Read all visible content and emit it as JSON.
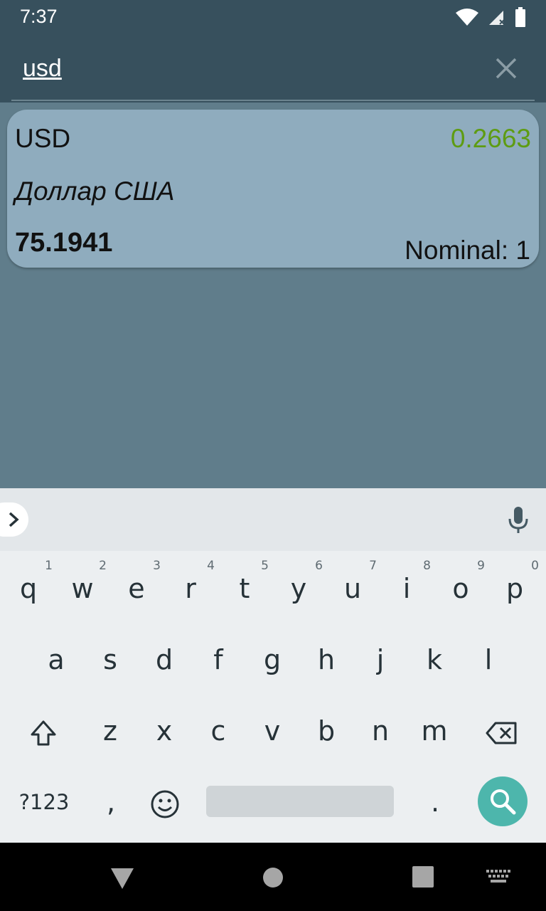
{
  "status_bar": {
    "time": "7:37",
    "icons": [
      "wifi-icon",
      "signal-icon",
      "battery-icon"
    ]
  },
  "search": {
    "value": "usd",
    "clear_icon": "close-icon"
  },
  "results": [
    {
      "code": "USD",
      "change": "0.2663",
      "name": "Доллар США",
      "value": "75.1941",
      "nominal": "Nominal: 1"
    }
  ],
  "colors": {
    "app_bar": "#37505d",
    "background": "#607d8b",
    "card": "#8facbe",
    "positive_change": "#5e9c12",
    "search_key": "#4db6ac"
  },
  "keyboard": {
    "row1": [
      {
        "key": "q",
        "hint": "1"
      },
      {
        "key": "w",
        "hint": "2"
      },
      {
        "key": "e",
        "hint": "3"
      },
      {
        "key": "r",
        "hint": "4"
      },
      {
        "key": "t",
        "hint": "5"
      },
      {
        "key": "y",
        "hint": "6"
      },
      {
        "key": "u",
        "hint": "7"
      },
      {
        "key": "i",
        "hint": "8"
      },
      {
        "key": "o",
        "hint": "9"
      },
      {
        "key": "p",
        "hint": "0"
      }
    ],
    "row2": [
      "a",
      "s",
      "d",
      "f",
      "g",
      "h",
      "j",
      "k",
      "l"
    ],
    "row3": [
      "z",
      "x",
      "c",
      "v",
      "b",
      "n",
      "m"
    ],
    "symbols_label": "?123",
    "comma_label": ",",
    "period_label": ".",
    "shift_icon": "shift-icon",
    "backspace_icon": "backspace-icon",
    "emoji_icon": "emoji-icon",
    "action_icon": "search-icon",
    "mic_icon": "mic-icon",
    "expand_icon": "chevron-right-icon"
  },
  "nav_bar": [
    "back-icon",
    "home-icon",
    "recents-icon",
    "keyboard-switch-icon"
  ]
}
